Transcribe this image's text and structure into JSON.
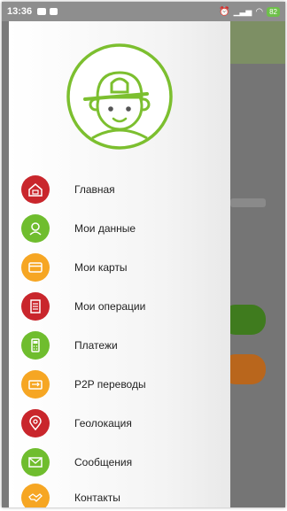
{
  "status": {
    "time": "13:36",
    "battery": "82"
  },
  "menu": {
    "items": [
      {
        "label": "Главная",
        "color": "#c9262c",
        "icon": "home-icon"
      },
      {
        "label": "Мои данные",
        "color": "#6fbd2e",
        "icon": "person-icon"
      },
      {
        "label": "Мои карты",
        "color": "#f6a623",
        "icon": "card-icon"
      },
      {
        "label": "Мои операции",
        "color": "#c9262c",
        "icon": "document-icon"
      },
      {
        "label": "Платежи",
        "color": "#6fbd2e",
        "icon": "pos-terminal-icon"
      },
      {
        "label": "P2P переводы",
        "color": "#f6a623",
        "icon": "transfer-icon"
      },
      {
        "label": "Геолокация",
        "color": "#c9262c",
        "icon": "location-pin-icon"
      },
      {
        "label": "Сообщения",
        "color": "#6fbd2e",
        "icon": "envelope-icon"
      },
      {
        "label": "Контакты",
        "color": "#f6a623",
        "icon": "handshake-icon"
      }
    ]
  }
}
